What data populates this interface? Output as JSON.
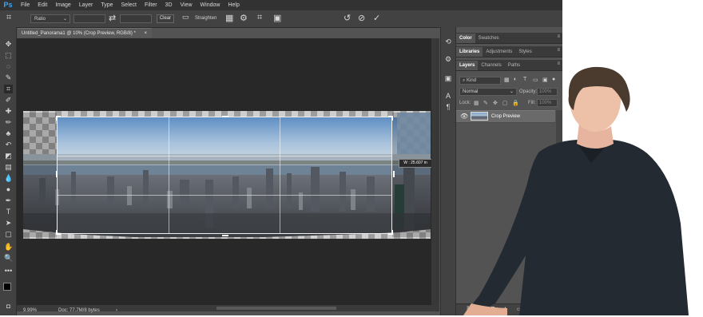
{
  "app": {
    "logo": "Ps"
  },
  "menu": [
    "File",
    "Edit",
    "Image",
    "Layer",
    "Type",
    "Select",
    "Filter",
    "3D",
    "View",
    "Window",
    "Help"
  ],
  "options": {
    "crop_tool_icon": "crop-icon",
    "ratio_value": "Ratio",
    "swap_icon": "swap-arrows-icon",
    "clear_label": "Clear",
    "straighten_label": "Straighten",
    "icons": [
      "straighten-icon",
      "overlay-grid-icon",
      "gear-icon",
      "content-aware-crop-icon",
      "delete-cropped-icon",
      "reset-icon",
      "cancel-icon",
      "commit-check-icon"
    ]
  },
  "document": {
    "tab_title": "Untitled_Panorama1 @ 10% (Crop Preview, RGB/8) *",
    "close_glyph": "×",
    "crop_readout": "W :  25.607 in",
    "zoom": "9.99%",
    "doc_info": "Doc: 77.7M/8 bytes",
    "status_arrow": "›"
  },
  "tools": [
    "move-icon",
    "marquee-icon",
    "lasso-icon",
    "quick-select-icon",
    "crop-icon",
    "eyedropper-icon",
    "healing-icon",
    "brush-icon",
    "clone-stamp-icon",
    "history-brush-icon",
    "eraser-icon",
    "gradient-icon",
    "blur-icon",
    "dodge-icon",
    "pen-icon",
    "type-icon",
    "path-select-icon",
    "shape-icon",
    "hand-icon",
    "zoom-icon",
    "more-tools-icon"
  ],
  "side_strip_icons": [
    "history-icon",
    "properties-icon",
    "adjust-icon",
    "character-icon",
    "paragraph-icon"
  ],
  "panels": {
    "top_tabs": [
      "Color",
      "Swatches"
    ],
    "mid_tabs": [
      "Libraries",
      "Adjustments",
      "Styles"
    ],
    "layer_tabs": [
      "Layers",
      "Channels",
      "Paths"
    ],
    "kind_placeholder": "Kind",
    "blend_mode": "Normal",
    "opacity_label": "Opacity:",
    "opacity_value": "100%",
    "lock_label": "Lock:",
    "fill_label": "Fill:",
    "fill_value": "100%",
    "layer_name": "Crop Preview",
    "layer_visible_icon": "eye-icon"
  },
  "colors": {
    "menu_bg": "#323232",
    "workspace_bg": "#282828",
    "panel_bg": "#535353",
    "ps_blue": "#31a8ff"
  }
}
